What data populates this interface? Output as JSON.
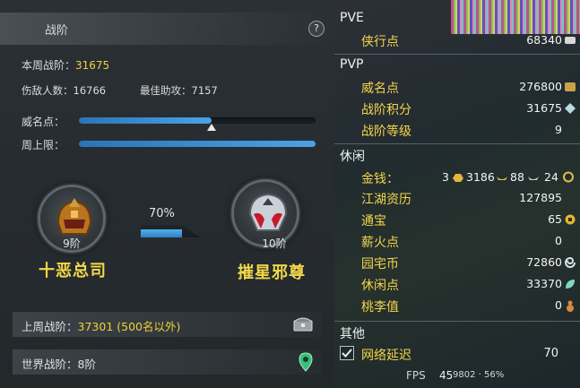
{
  "rank_panel": {
    "title": "战阶",
    "help": "?",
    "this_week_label": "本周战阶：",
    "this_week_value": "31675",
    "defeat_label": "伤敌人数：",
    "defeat_value": "16766",
    "assist_label": "最佳助攻：",
    "assist_value": "7157",
    "prestige_label": "威名点：",
    "prestige_fraction": 0.56,
    "weekly_cap_label": "周上限：",
    "weekly_cap_fraction": 1.0,
    "current_rank": {
      "tier": "9阶",
      "name": "十恶总司"
    },
    "next_rank": {
      "tier": "10阶",
      "name": "摧星邪尊"
    },
    "progress_pct_text": "70%",
    "progress_fraction": 0.7,
    "last_week_label": "上周战阶：",
    "last_week_value": "37301 (500名以外)",
    "world_label": "世界战阶：",
    "world_value": "8阶"
  },
  "resources": {
    "pve_title": "PVE",
    "pve_items": [
      {
        "label": "侠行点",
        "value": "68340"
      }
    ],
    "pvp_title": "PVP",
    "pvp_items": [
      {
        "label": "威名点",
        "value": "276800"
      },
      {
        "label": "战阶积分",
        "value": "31675"
      },
      {
        "label": "战阶等级",
        "value": "9"
      }
    ],
    "leisure_title": "休闲",
    "money": {
      "label": "金钱：",
      "gold": "3",
      "silver": "3186",
      "copper": "88",
      "tael": "24"
    },
    "leisure_items": [
      {
        "label": "江湖资历",
        "value": "127895"
      },
      {
        "label": "通宝",
        "value": "65"
      },
      {
        "label": "薪火点",
        "value": "0"
      },
      {
        "label": "园宅币",
        "value": "72860"
      },
      {
        "label": "休闲点",
        "value": "33370"
      },
      {
        "label": "桃李值",
        "value": "0"
      }
    ],
    "other_title": "其他",
    "latency_label": "网络延迟",
    "latency_value": "70",
    "fps_label": "FPS",
    "fps_value": "45",
    "fps_tail": "9802 · 56%"
  },
  "colors": {
    "accent_yellow": "#f2cf3a",
    "bar_blue": "#3a8fd6"
  }
}
